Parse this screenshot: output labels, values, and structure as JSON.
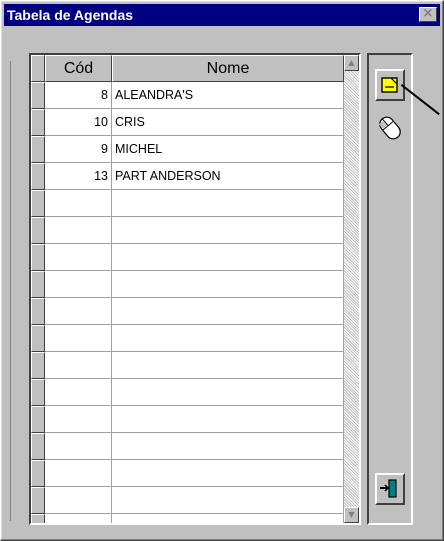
{
  "window": {
    "title": "Tabela de Agendas",
    "close_glyph": "×"
  },
  "grid": {
    "columns": [
      {
        "key": "cod",
        "label": "Cód"
      },
      {
        "key": "nome",
        "label": "Nome"
      }
    ],
    "rows": [
      {
        "cod": "8",
        "nome": "ALEANDRA'S"
      },
      {
        "cod": "10",
        "nome": "CRIS"
      },
      {
        "cod": "9",
        "nome": "MICHEL"
      },
      {
        "cod": "13",
        "nome": "PART ANDERSON"
      }
    ],
    "empty_row_count": 13
  },
  "side_panel": {
    "buttons": [
      {
        "name": "new-record-button",
        "icon": "new-document-icon"
      },
      {
        "name": "mouse-hint",
        "icon": "mouse-icon"
      },
      {
        "name": "exit-button",
        "icon": "exit-door-icon"
      }
    ]
  },
  "colors": {
    "titlebar": "#000080",
    "face": "#c0c0c0",
    "icon_yellow": "#ffff00",
    "icon_teal": "#008080"
  }
}
